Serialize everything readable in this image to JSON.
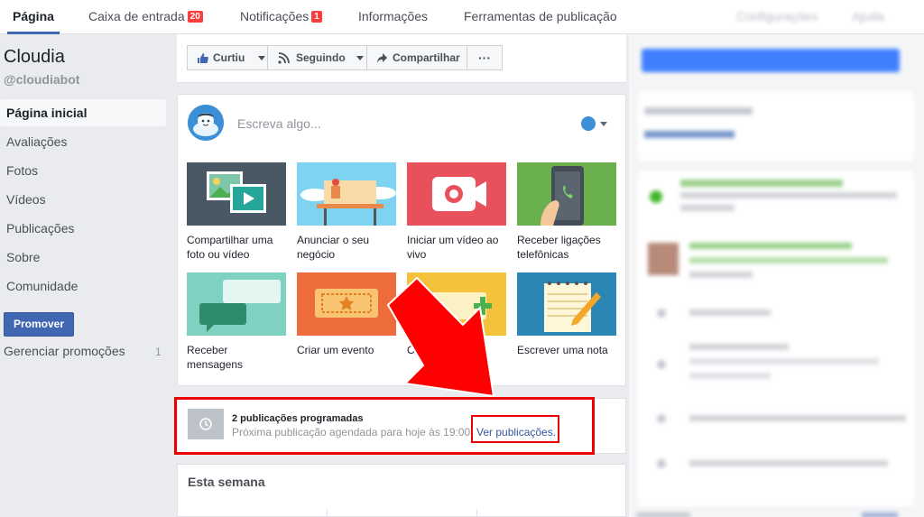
{
  "topnav": {
    "tabs": [
      {
        "label": "Página"
      },
      {
        "label": "Caixa de entrada",
        "badge": "20"
      },
      {
        "label": "Notificações",
        "badge": "1"
      },
      {
        "label": "Informações"
      },
      {
        "label": "Ferramentas de publicação"
      }
    ],
    "right_tabs": [
      "Configurações",
      "Ajuda"
    ]
  },
  "page": {
    "name": "Cloudia",
    "handle": "@cloudiabot"
  },
  "sidebar": {
    "items": [
      {
        "label": "Página inicial"
      },
      {
        "label": "Avaliações"
      },
      {
        "label": "Fotos"
      },
      {
        "label": "Vídeos"
      },
      {
        "label": "Publicações"
      },
      {
        "label": "Sobre"
      },
      {
        "label": "Comunidade"
      }
    ],
    "promote_label": "Promover",
    "manage_label": "Gerenciar promoções",
    "manage_count": "1"
  },
  "actions": {
    "like": "Curtiu",
    "following": "Seguindo",
    "share": "Compartilhar",
    "more": "···"
  },
  "composer": {
    "placeholder": "Escreva algo...",
    "tiles": [
      {
        "label": "Compartilhar uma foto ou vídeo",
        "color": "#4a5866"
      },
      {
        "label": "Anunciar o seu negócio",
        "color": "#7dd3f0"
      },
      {
        "label": "Iniciar um vídeo ao vivo",
        "color": "#e8505b"
      },
      {
        "label": "Receber ligações telefônicas",
        "color": "#6ab04c"
      },
      {
        "label": "Receber mensagens",
        "color": "#7fd1c2"
      },
      {
        "label": "Criar um evento",
        "color": "#ee6b3b"
      },
      {
        "label": "Criar oferta",
        "color": "#f4c33b"
      },
      {
        "label": "Escrever uma nota",
        "color": "#2b85b5"
      }
    ]
  },
  "scheduled": {
    "title": "2 publicações programadas",
    "subtitle": "Próxima publicação agendada para hoje às 19:00.",
    "link": "Ver publicações."
  },
  "week": {
    "title": "Esta semana"
  },
  "colors": {
    "accent": "#4267b2",
    "highlight": "#ee0000",
    "link": "#365899"
  }
}
